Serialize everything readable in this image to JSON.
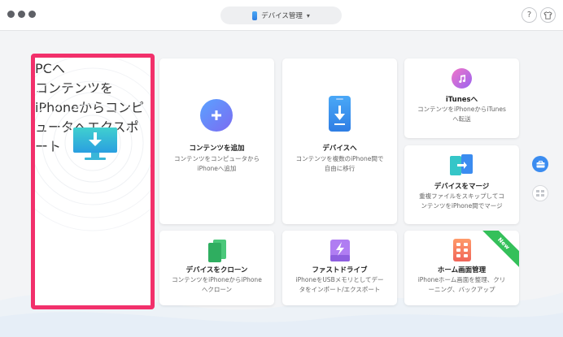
{
  "device_selector": {
    "label": "デバイス管理",
    "chevron": "▾"
  },
  "topright": {
    "help_label": "?",
    "shirt_icon": "shirt-icon"
  },
  "cards": {
    "pc": {
      "title": "PCへ",
      "desc_line1": "コンテンツをiPhoneからコンピ",
      "desc_line2": "ュータへエクスポート"
    },
    "add": {
      "title": "コンテンツを追加",
      "desc_line1": "コンテンツをコンピュータから",
      "desc_line2": "iPhoneへ追加"
    },
    "device": {
      "title": "デバイスへ",
      "desc_line1": "コンテンツを複数のiPhone間で",
      "desc_line2": "自由に移行"
    },
    "itunes": {
      "title": "iTunesへ",
      "desc_line1": "コンテンツをiPhoneからiTunes",
      "desc_line2": "へ転送"
    },
    "merge": {
      "title": "デバイスをマージ",
      "desc_line1": "重複ファイルをスキップしてコ",
      "desc_line2": "ンテンツをiPhone間でマージ"
    },
    "clone": {
      "title": "デバイスをクローン",
      "desc_line1": "コンテンツをiPhoneからiPhone",
      "desc_line2": "へクローン"
    },
    "fastdrive": {
      "title": "ファストドライブ",
      "desc_line1": "iPhoneをUSBメモリとしてデー",
      "desc_line2": "タをインポート/エクスポート"
    },
    "homescreen": {
      "title": "ホーム画面管理",
      "desc_line1": "iPhoneホーム画面を整理、クリ",
      "desc_line2": "ーニング、バックアップ",
      "badge": "New"
    }
  },
  "colors": {
    "highlight": "#f2306b",
    "accent_blue": "#3b8cf0",
    "new_badge": "#34c05a"
  }
}
